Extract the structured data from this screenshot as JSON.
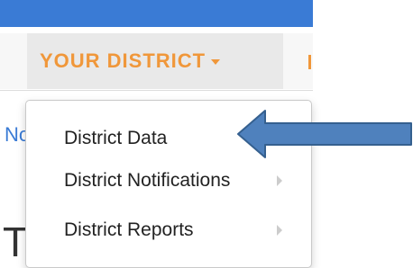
{
  "nav": {
    "active_item_label": "YOUR DISTRICT",
    "active_color": "#f0973a"
  },
  "page_fragments": {
    "link_partial": "No",
    "heading_partial": "T"
  },
  "dropdown": {
    "items": [
      {
        "label": "District Data",
        "has_submenu": false
      },
      {
        "label": "District Notifications",
        "has_submenu": true
      },
      {
        "label": "District Reports",
        "has_submenu": true
      }
    ]
  },
  "annotation": {
    "arrow_icon": "left-arrow-icon",
    "arrow_color": "#4f81bd",
    "points_to": "District Data"
  }
}
